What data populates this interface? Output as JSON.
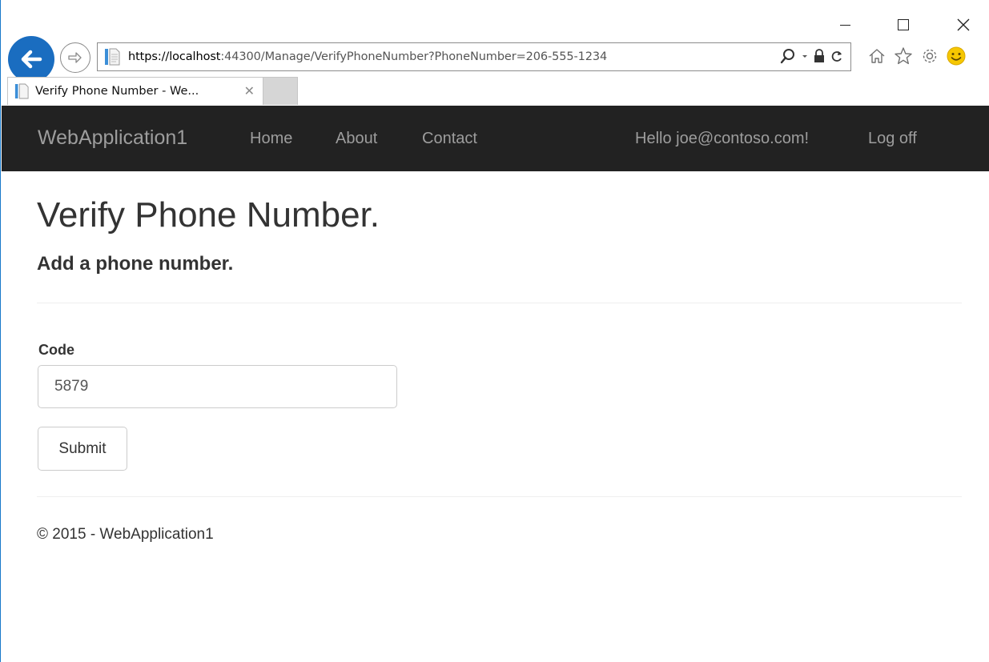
{
  "browser": {
    "address": {
      "scheme": "https://",
      "host": "localhost",
      "rest": ":44300/Manage/VerifyPhoneNumber?PhoneNumber=206-555-1234"
    },
    "tab": {
      "title": "Verify Phone Number - We...",
      "close_glyph": "✕"
    },
    "window_controls": {
      "close_glyph": "✕"
    }
  },
  "navbar": {
    "brand": "WebApplication1",
    "links": [
      "Home",
      "About",
      "Contact"
    ],
    "greeting": "Hello joe@contoso.com!",
    "logoff": "Log off"
  },
  "main": {
    "title": "Verify Phone Number.",
    "subtitle": "Add a phone number.",
    "form": {
      "code_label": "Code",
      "code_value": "5879",
      "submit_label": "Submit"
    }
  },
  "footer": {
    "text": "© 2015 - WebApplication1"
  }
}
